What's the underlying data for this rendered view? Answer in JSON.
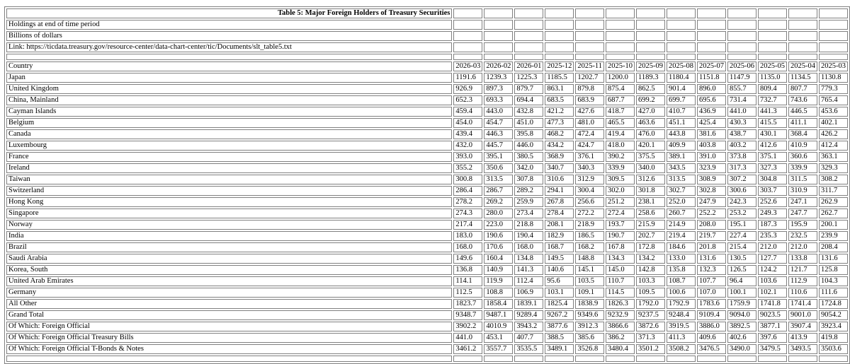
{
  "table_title": "Table 5: Major Foreign Holders of Treasury Securities",
  "meta": [
    "Holdings at end of time period",
    "Billions of dollars",
    "Link: https://ticdata.treasury.gov/resource-center/data-chart-center/tic/Documents/slt_table5.txt"
  ],
  "header_label": "Country",
  "periods": [
    "2026-03",
    "2026-02",
    "2026-01",
    "2025-12",
    "2025-11",
    "2025-10",
    "2025-09",
    "2025-08",
    "2025-07",
    "2025-06",
    "2025-05",
    "2025-04",
    "2025-03"
  ],
  "rows": [
    {
      "country": "Japan",
      "values": [
        "1191.6",
        "1239.3",
        "1225.3",
        "1185.5",
        "1202.7",
        "1200.0",
        "1189.3",
        "1180.4",
        "1151.8",
        "1147.9",
        "1135.0",
        "1134.5",
        "1130.8"
      ]
    },
    {
      "country": "United Kingdom",
      "values": [
        "926.9",
        "897.3",
        "879.7",
        "863.1",
        "879.8",
        "875.4",
        "862.5",
        "901.4",
        "896.0",
        "855.7",
        "809.4",
        "807.7",
        "779.3"
      ]
    },
    {
      "country": "China, Mainland",
      "values": [
        "652.3",
        "693.3",
        "694.4",
        "683.5",
        "683.9",
        "687.7",
        "699.2",
        "699.7",
        "695.6",
        "731.4",
        "732.7",
        "743.6",
        "765.4"
      ]
    },
    {
      "country": "Cayman Islands",
      "values": [
        "459.4",
        "443.0",
        "432.8",
        "421.2",
        "427.6",
        "418.7",
        "427.0",
        "410.7",
        "436.9",
        "441.0",
        "441.3",
        "446.5",
        "453.6"
      ]
    },
    {
      "country": "Belgium",
      "values": [
        "454.0",
        "454.7",
        "451.0",
        "477.3",
        "481.0",
        "465.5",
        "463.6",
        "451.1",
        "425.4",
        "430.3",
        "415.5",
        "411.1",
        "402.1"
      ]
    },
    {
      "country": "Canada",
      "values": [
        "439.4",
        "446.3",
        "395.8",
        "468.2",
        "472.4",
        "419.4",
        "476.0",
        "443.8",
        "381.6",
        "438.7",
        "430.1",
        "368.4",
        "426.2"
      ]
    },
    {
      "country": "Luxembourg",
      "values": [
        "432.0",
        "445.7",
        "446.0",
        "434.2",
        "424.7",
        "418.0",
        "420.1",
        "409.9",
        "403.8",
        "403.2",
        "412.6",
        "410.9",
        "412.4"
      ]
    },
    {
      "country": "France",
      "values": [
        "393.0",
        "395.1",
        "380.5",
        "368.9",
        "376.1",
        "390.2",
        "375.5",
        "389.1",
        "391.0",
        "373.8",
        "375.1",
        "360.6",
        "363.1"
      ]
    },
    {
      "country": "Ireland",
      "values": [
        "355.2",
        "350.6",
        "342.0",
        "340.7",
        "340.3",
        "339.9",
        "340.0",
        "343.5",
        "323.9",
        "317.3",
        "327.3",
        "339.9",
        "329.3"
      ]
    },
    {
      "country": "Taiwan",
      "values": [
        "300.8",
        "313.5",
        "307.8",
        "310.6",
        "312.9",
        "309.5",
        "312.6",
        "313.5",
        "308.9",
        "307.2",
        "304.8",
        "311.5",
        "308.2"
      ]
    },
    {
      "country": "Switzerland",
      "values": [
        "286.4",
        "286.7",
        "289.2",
        "294.1",
        "300.4",
        "302.0",
        "301.8",
        "302.7",
        "302.8",
        "300.6",
        "303.7",
        "310.9",
        "311.7"
      ]
    },
    {
      "country": "Hong Kong",
      "values": [
        "278.2",
        "269.2",
        "259.9",
        "267.8",
        "256.6",
        "251.2",
        "238.1",
        "252.0",
        "247.9",
        "242.3",
        "252.6",
        "247.1",
        "262.9"
      ]
    },
    {
      "country": "Singapore",
      "values": [
        "274.3",
        "280.0",
        "273.4",
        "278.4",
        "272.2",
        "272.4",
        "258.6",
        "260.7",
        "252.2",
        "253.2",
        "249.3",
        "247.7",
        "262.7"
      ]
    },
    {
      "country": "Norway",
      "values": [
        "217.4",
        "223.0",
        "218.8",
        "208.1",
        "218.9",
        "193.7",
        "215.9",
        "214.9",
        "208.0",
        "195.1",
        "187.3",
        "195.9",
        "200.1"
      ]
    },
    {
      "country": "India",
      "values": [
        "183.0",
        "190.6",
        "190.4",
        "182.9",
        "186.5",
        "190.7",
        "202.7",
        "219.4",
        "219.7",
        "227.4",
        "235.3",
        "232.5",
        "239.9"
      ]
    },
    {
      "country": "Brazil",
      "values": [
        "168.0",
        "170.6",
        "168.0",
        "168.7",
        "168.2",
        "167.8",
        "172.8",
        "184.6",
        "201.8",
        "215.4",
        "212.0",
        "212.0",
        "208.4"
      ]
    },
    {
      "country": "Saudi Arabia",
      "values": [
        "149.6",
        "160.4",
        "134.8",
        "149.5",
        "148.8",
        "134.3",
        "134.2",
        "133.0",
        "131.6",
        "130.5",
        "127.7",
        "133.8",
        "131.6"
      ]
    },
    {
      "country": "Korea, South",
      "values": [
        "136.8",
        "140.9",
        "141.3",
        "140.6",
        "145.1",
        "145.0",
        "142.8",
        "135.8",
        "132.3",
        "126.5",
        "124.2",
        "121.7",
        "125.8"
      ]
    },
    {
      "country": "United Arab Emirates",
      "values": [
        "114.1",
        "119.9",
        "112.4",
        "95.6",
        "103.5",
        "110.7",
        "103.3",
        "108.7",
        "107.7",
        "96.4",
        "103.6",
        "112.9",
        "104.3"
      ]
    },
    {
      "country": "Germany",
      "values": [
        "112.5",
        "108.8",
        "106.9",
        "103.1",
        "109.1",
        "114.5",
        "109.5",
        "100.6",
        "107.0",
        "100.1",
        "102.1",
        "110.6",
        "111.6"
      ]
    },
    {
      "country": "All Other",
      "values": [
        "1823.7",
        "1858.4",
        "1839.1",
        "1825.4",
        "1838.9",
        "1826.3",
        "1792.0",
        "1792.9",
        "1783.6",
        "1759.9",
        "1741.8",
        "1741.4",
        "1724.8"
      ]
    },
    {
      "country": "Grand Total",
      "values": [
        "9348.7",
        "9487.1",
        "9289.4",
        "9267.2",
        "9349.6",
        "9232.9",
        "9237.5",
        "9248.4",
        "9109.4",
        "9094.0",
        "9023.5",
        "9001.0",
        "9054.2"
      ]
    },
    {
      "country": "Of Which: Foreign Official",
      "values": [
        "3902.2",
        "4010.9",
        "3943.2",
        "3877.6",
        "3912.3",
        "3866.6",
        "3872.6",
        "3919.5",
        "3886.0",
        "3892.5",
        "3877.1",
        "3907.4",
        "3923.4"
      ]
    },
    {
      "country": "Of Which: Foreign Official Treasury Bills",
      "values": [
        "441.0",
        "453.1",
        "407.7",
        "388.5",
        "385.6",
        "386.2",
        "371.3",
        "411.3",
        "409.6",
        "402.6",
        "397.6",
        "413.9",
        "419.8"
      ]
    },
    {
      "country": "Of Which: Foreign Official T-Bonds & Notes",
      "values": [
        "3461.2",
        "3557.7",
        "3535.5",
        "3489.1",
        "3526.8",
        "3480.4",
        "3501.2",
        "3508.2",
        "3476.5",
        "3490.0",
        "3479.5",
        "3493.5",
        "3503.6"
      ]
    }
  ]
}
